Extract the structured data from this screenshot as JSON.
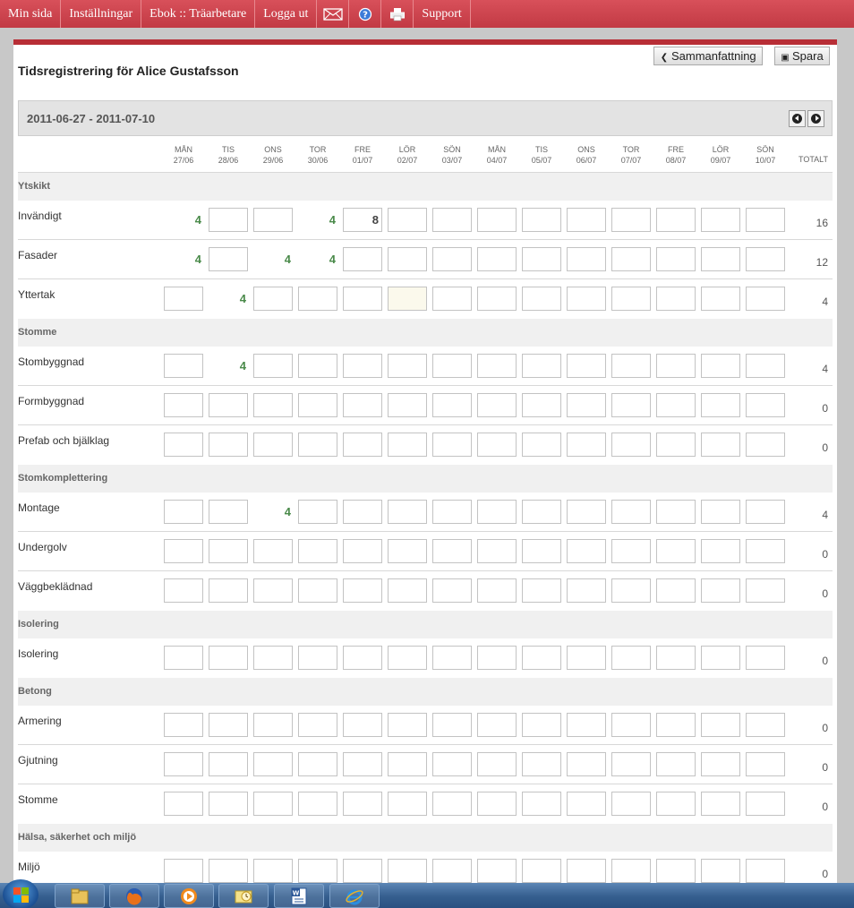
{
  "nav": {
    "items": [
      {
        "label": "Min sida"
      },
      {
        "label": "Inställningar"
      },
      {
        "label": "Ebok :: Träarbetare"
      },
      {
        "label": "Logga ut"
      },
      {
        "icon": "mail-icon"
      },
      {
        "icon": "help-icon"
      },
      {
        "icon": "print-icon"
      },
      {
        "label": "Support"
      }
    ]
  },
  "colors": {
    "nav_red": "#c8424c",
    "accent_red": "#b82e36",
    "value_green": "#4a8a4a",
    "weekend_cell": "#fbf9ec"
  },
  "page": {
    "title": "Tidsregistrering för Alice Gustafsson",
    "summary_button": "Sammanfattning",
    "summary_icon": "chevron-left-icon",
    "save_button": "Spara",
    "save_icon": "floppy-disk-icon"
  },
  "range": {
    "text": "2011-06-27 - 2011-07-10",
    "prev_icon": "arrow-left-icon",
    "next_icon": "arrow-right-icon"
  },
  "days": [
    {
      "name": "MÅN",
      "date": "27/06"
    },
    {
      "name": "TIS",
      "date": "28/06"
    },
    {
      "name": "ONS",
      "date": "29/06"
    },
    {
      "name": "TOR",
      "date": "30/06"
    },
    {
      "name": "FRE",
      "date": "01/07"
    },
    {
      "name": "LÖR",
      "date": "02/07"
    },
    {
      "name": "SÖN",
      "date": "03/07"
    },
    {
      "name": "MÅN",
      "date": "04/07"
    },
    {
      "name": "TIS",
      "date": "05/07"
    },
    {
      "name": "ONS",
      "date": "06/07"
    },
    {
      "name": "TOR",
      "date": "07/07"
    },
    {
      "name": "FRE",
      "date": "08/07"
    },
    {
      "name": "LÖR",
      "date": "09/07"
    },
    {
      "name": "SÖN",
      "date": "10/07"
    }
  ],
  "total_label": "TOTALT",
  "categories": [
    {
      "name": "Ytskikt",
      "tasks": [
        {
          "name": "Invändigt",
          "total": "16",
          "cells": [
            "4",
            null,
            null,
            "4",
            "[8]",
            null,
            null,
            null,
            null,
            null,
            null,
            null,
            null,
            null
          ]
        },
        {
          "name": "Fasader",
          "total": "12",
          "cells": [
            "4",
            null,
            "4",
            "4",
            null,
            null,
            null,
            null,
            null,
            null,
            null,
            null,
            null,
            null
          ]
        },
        {
          "name": "Yttertak",
          "total": "4",
          "cells": [
            null,
            "4",
            null,
            null,
            null,
            "[W]",
            null,
            null,
            null,
            null,
            null,
            null,
            null,
            null
          ]
        }
      ]
    },
    {
      "name": "Stomme",
      "tasks": [
        {
          "name": "Stombyggnad",
          "total": "4",
          "cells": [
            null,
            "4",
            null,
            null,
            null,
            null,
            null,
            null,
            null,
            null,
            null,
            null,
            null,
            null
          ]
        },
        {
          "name": "Formbyggnad",
          "total": "0",
          "cells": [
            null,
            null,
            null,
            null,
            null,
            null,
            null,
            null,
            null,
            null,
            null,
            null,
            null,
            null
          ]
        },
        {
          "name": "Prefab och bjälklag",
          "total": "0",
          "cells": [
            null,
            null,
            null,
            null,
            null,
            null,
            null,
            null,
            null,
            null,
            null,
            null,
            null,
            null
          ]
        }
      ]
    },
    {
      "name": "Stomkomplettering",
      "tasks": [
        {
          "name": "Montage",
          "total": "4",
          "cells": [
            null,
            null,
            "4",
            null,
            null,
            null,
            null,
            null,
            null,
            null,
            null,
            null,
            null,
            null
          ]
        },
        {
          "name": "Undergolv",
          "total": "0",
          "cells": [
            null,
            null,
            null,
            null,
            null,
            null,
            null,
            null,
            null,
            null,
            null,
            null,
            null,
            null
          ]
        },
        {
          "name": "Väggbeklädnad",
          "total": "0",
          "cells": [
            null,
            null,
            null,
            null,
            null,
            null,
            null,
            null,
            null,
            null,
            null,
            null,
            null,
            null
          ]
        }
      ]
    },
    {
      "name": "Isolering",
      "tasks": [
        {
          "name": "Isolering",
          "total": "0",
          "cells": [
            null,
            null,
            null,
            null,
            null,
            null,
            null,
            null,
            null,
            null,
            null,
            null,
            null,
            null
          ]
        }
      ]
    },
    {
      "name": "Betong",
      "tasks": [
        {
          "name": "Armering",
          "total": "0",
          "cells": [
            null,
            null,
            null,
            null,
            null,
            null,
            null,
            null,
            null,
            null,
            null,
            null,
            null,
            null
          ]
        },
        {
          "name": "Gjutning",
          "total": "0",
          "cells": [
            null,
            null,
            null,
            null,
            null,
            null,
            null,
            null,
            null,
            null,
            null,
            null,
            null,
            null
          ]
        },
        {
          "name": "Stomme",
          "total": "0",
          "cells": [
            null,
            null,
            null,
            null,
            null,
            null,
            null,
            null,
            null,
            null,
            null,
            null,
            null,
            null
          ]
        }
      ]
    },
    {
      "name": "Hälsa, säkerhet och miljö",
      "tasks": [
        {
          "name": "Miljö",
          "total": "0",
          "cells": [
            null,
            null,
            null,
            null,
            null,
            null,
            null,
            null,
            null,
            null,
            null,
            null,
            null,
            null
          ]
        }
      ]
    }
  ],
  "taskbar": {
    "start_icon": "windows-start-icon",
    "apps": [
      {
        "icon": "explorer-folder-icon"
      },
      {
        "icon": "firefox-icon"
      },
      {
        "icon": "media-player-icon"
      },
      {
        "icon": "outlook-icon"
      },
      {
        "icon": "word-icon"
      },
      {
        "icon": "internet-explorer-icon"
      }
    ]
  }
}
